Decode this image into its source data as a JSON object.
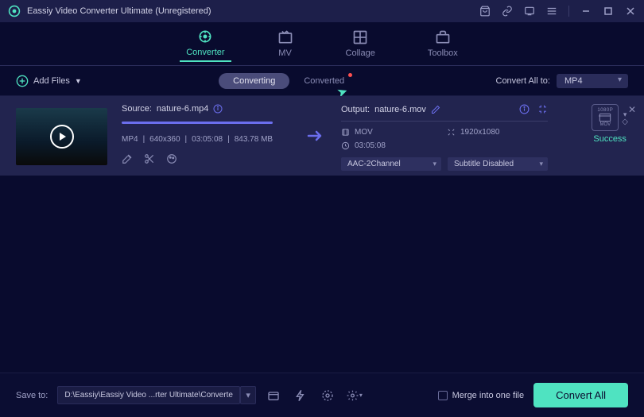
{
  "title": "Eassiy Video Converter Ultimate (Unregistered)",
  "nav": {
    "converter": "Converter",
    "mv": "MV",
    "collage": "Collage",
    "toolbox": "Toolbox"
  },
  "subbar": {
    "add_files": "Add Files",
    "converting": "Converting",
    "converted": "Converted",
    "convert_all_to": "Convert All to:",
    "format": "MP4"
  },
  "file": {
    "source_label": "Source:",
    "source_name": "nature-6.mp4",
    "meta": {
      "format": "MP4",
      "resolution": "640x360",
      "duration": "03:05:08",
      "size": "843.78 MB"
    },
    "output_label": "Output:",
    "output_name": "nature-6.mov",
    "out": {
      "format": "MOV",
      "resolution": "1920x1080",
      "duration": "03:05:08"
    },
    "audio": "AAC-2Channel",
    "subtitle": "Subtitle Disabled",
    "format_badge_top": "1080P",
    "format_badge_bottom": "MOV",
    "status": "Success"
  },
  "footer": {
    "save_to": "Save to:",
    "path": "D:\\Eassiy\\Eassiy Video ...rter Ultimate\\Converted",
    "merge": "Merge into one file",
    "convert_all": "Convert All"
  }
}
